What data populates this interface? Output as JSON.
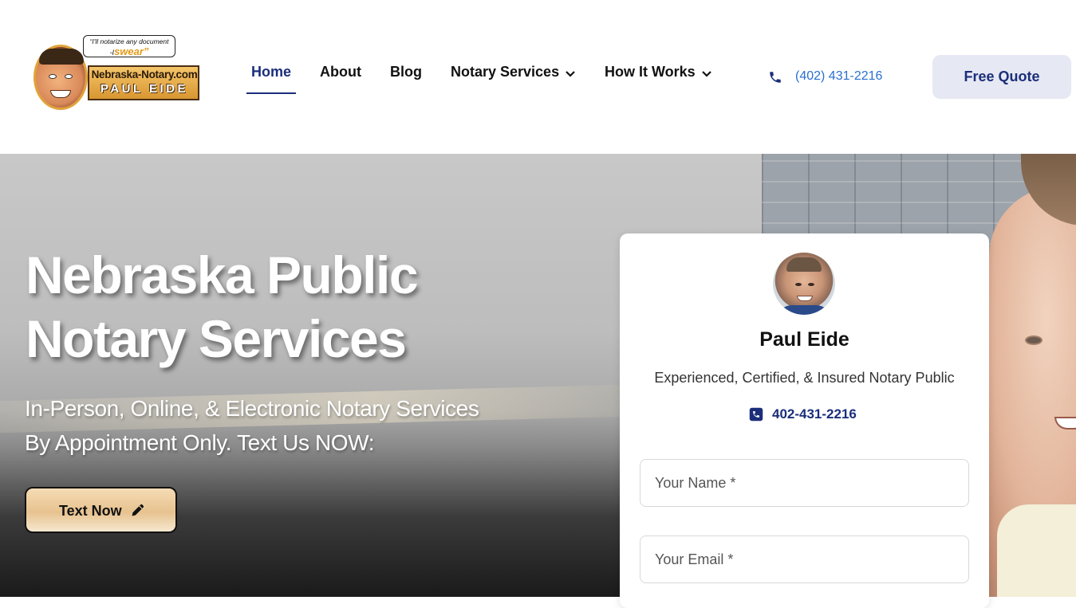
{
  "logo": {
    "bubble_line1": "“I'll notarize any document",
    "bubble_prefix": "-I",
    "bubble_word": "swear”",
    "plate_line1": "Nebraska-Notary.com",
    "plate_line2": "PAUL EIDE"
  },
  "nav": {
    "items": [
      {
        "label": "Home",
        "active": true
      },
      {
        "label": "About"
      },
      {
        "label": "Blog"
      },
      {
        "label": "Notary Services",
        "dropdown": true
      },
      {
        "label": "How It Works",
        "dropdown": true
      }
    ]
  },
  "header": {
    "phone": "(402) 431-2216",
    "cta": "Free Quote"
  },
  "hero": {
    "title_line1": "Nebraska Public",
    "title_line2": "Notary Services",
    "sub_line1": "In-Person, Online, & Electronic Notary Services",
    "sub_line2": "By Appointment Only. Text Us NOW:",
    "button": "Text Now"
  },
  "card": {
    "name": "Paul Eide",
    "title": "Experienced, Certified, & Insured Notary Public",
    "phone": "402-431-2216",
    "name_placeholder": "Your Name *",
    "email_placeholder": "Your Email *"
  },
  "colors": {
    "brand_navy": "#1b2e7a",
    "link_blue": "#2b6fcf",
    "quote_bg": "#e6e8f3"
  }
}
